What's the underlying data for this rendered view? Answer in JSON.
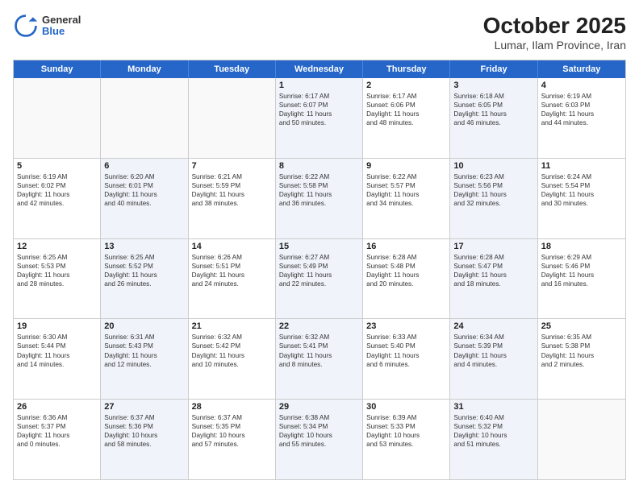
{
  "header": {
    "logo_general": "General",
    "logo_blue": "Blue",
    "title": "October 2025",
    "subtitle": "Lumar, Ilam Province, Iran"
  },
  "weekdays": [
    "Sunday",
    "Monday",
    "Tuesday",
    "Wednesday",
    "Thursday",
    "Friday",
    "Saturday"
  ],
  "rows": [
    [
      {
        "day": "",
        "lines": [],
        "empty": true
      },
      {
        "day": "",
        "lines": [],
        "empty": true
      },
      {
        "day": "",
        "lines": [],
        "empty": true
      },
      {
        "day": "1",
        "lines": [
          "Sunrise: 6:17 AM",
          "Sunset: 6:07 PM",
          "Daylight: 11 hours",
          "and 50 minutes."
        ],
        "shaded": true
      },
      {
        "day": "2",
        "lines": [
          "Sunrise: 6:17 AM",
          "Sunset: 6:06 PM",
          "Daylight: 11 hours",
          "and 48 minutes."
        ]
      },
      {
        "day": "3",
        "lines": [
          "Sunrise: 6:18 AM",
          "Sunset: 6:05 PM",
          "Daylight: 11 hours",
          "and 46 minutes."
        ],
        "shaded": true
      },
      {
        "day": "4",
        "lines": [
          "Sunrise: 6:19 AM",
          "Sunset: 6:03 PM",
          "Daylight: 11 hours",
          "and 44 minutes."
        ]
      }
    ],
    [
      {
        "day": "5",
        "lines": [
          "Sunrise: 6:19 AM",
          "Sunset: 6:02 PM",
          "Daylight: 11 hours",
          "and 42 minutes."
        ]
      },
      {
        "day": "6",
        "lines": [
          "Sunrise: 6:20 AM",
          "Sunset: 6:01 PM",
          "Daylight: 11 hours",
          "and 40 minutes."
        ],
        "shaded": true
      },
      {
        "day": "7",
        "lines": [
          "Sunrise: 6:21 AM",
          "Sunset: 5:59 PM",
          "Daylight: 11 hours",
          "and 38 minutes."
        ]
      },
      {
        "day": "8",
        "lines": [
          "Sunrise: 6:22 AM",
          "Sunset: 5:58 PM",
          "Daylight: 11 hours",
          "and 36 minutes."
        ],
        "shaded": true
      },
      {
        "day": "9",
        "lines": [
          "Sunrise: 6:22 AM",
          "Sunset: 5:57 PM",
          "Daylight: 11 hours",
          "and 34 minutes."
        ]
      },
      {
        "day": "10",
        "lines": [
          "Sunrise: 6:23 AM",
          "Sunset: 5:56 PM",
          "Daylight: 11 hours",
          "and 32 minutes."
        ],
        "shaded": true
      },
      {
        "day": "11",
        "lines": [
          "Sunrise: 6:24 AM",
          "Sunset: 5:54 PM",
          "Daylight: 11 hours",
          "and 30 minutes."
        ]
      }
    ],
    [
      {
        "day": "12",
        "lines": [
          "Sunrise: 6:25 AM",
          "Sunset: 5:53 PM",
          "Daylight: 11 hours",
          "and 28 minutes."
        ]
      },
      {
        "day": "13",
        "lines": [
          "Sunrise: 6:25 AM",
          "Sunset: 5:52 PM",
          "Daylight: 11 hours",
          "and 26 minutes."
        ],
        "shaded": true
      },
      {
        "day": "14",
        "lines": [
          "Sunrise: 6:26 AM",
          "Sunset: 5:51 PM",
          "Daylight: 11 hours",
          "and 24 minutes."
        ]
      },
      {
        "day": "15",
        "lines": [
          "Sunrise: 6:27 AM",
          "Sunset: 5:49 PM",
          "Daylight: 11 hours",
          "and 22 minutes."
        ],
        "shaded": true
      },
      {
        "day": "16",
        "lines": [
          "Sunrise: 6:28 AM",
          "Sunset: 5:48 PM",
          "Daylight: 11 hours",
          "and 20 minutes."
        ]
      },
      {
        "day": "17",
        "lines": [
          "Sunrise: 6:28 AM",
          "Sunset: 5:47 PM",
          "Daylight: 11 hours",
          "and 18 minutes."
        ],
        "shaded": true
      },
      {
        "day": "18",
        "lines": [
          "Sunrise: 6:29 AM",
          "Sunset: 5:46 PM",
          "Daylight: 11 hours",
          "and 16 minutes."
        ]
      }
    ],
    [
      {
        "day": "19",
        "lines": [
          "Sunrise: 6:30 AM",
          "Sunset: 5:44 PM",
          "Daylight: 11 hours",
          "and 14 minutes."
        ]
      },
      {
        "day": "20",
        "lines": [
          "Sunrise: 6:31 AM",
          "Sunset: 5:43 PM",
          "Daylight: 11 hours",
          "and 12 minutes."
        ],
        "shaded": true
      },
      {
        "day": "21",
        "lines": [
          "Sunrise: 6:32 AM",
          "Sunset: 5:42 PM",
          "Daylight: 11 hours",
          "and 10 minutes."
        ]
      },
      {
        "day": "22",
        "lines": [
          "Sunrise: 6:32 AM",
          "Sunset: 5:41 PM",
          "Daylight: 11 hours",
          "and 8 minutes."
        ],
        "shaded": true
      },
      {
        "day": "23",
        "lines": [
          "Sunrise: 6:33 AM",
          "Sunset: 5:40 PM",
          "Daylight: 11 hours",
          "and 6 minutes."
        ]
      },
      {
        "day": "24",
        "lines": [
          "Sunrise: 6:34 AM",
          "Sunset: 5:39 PM",
          "Daylight: 11 hours",
          "and 4 minutes."
        ],
        "shaded": true
      },
      {
        "day": "25",
        "lines": [
          "Sunrise: 6:35 AM",
          "Sunset: 5:38 PM",
          "Daylight: 11 hours",
          "and 2 minutes."
        ]
      }
    ],
    [
      {
        "day": "26",
        "lines": [
          "Sunrise: 6:36 AM",
          "Sunset: 5:37 PM",
          "Daylight: 11 hours",
          "and 0 minutes."
        ]
      },
      {
        "day": "27",
        "lines": [
          "Sunrise: 6:37 AM",
          "Sunset: 5:36 PM",
          "Daylight: 10 hours",
          "and 58 minutes."
        ],
        "shaded": true
      },
      {
        "day": "28",
        "lines": [
          "Sunrise: 6:37 AM",
          "Sunset: 5:35 PM",
          "Daylight: 10 hours",
          "and 57 minutes."
        ]
      },
      {
        "day": "29",
        "lines": [
          "Sunrise: 6:38 AM",
          "Sunset: 5:34 PM",
          "Daylight: 10 hours",
          "and 55 minutes."
        ],
        "shaded": true
      },
      {
        "day": "30",
        "lines": [
          "Sunrise: 6:39 AM",
          "Sunset: 5:33 PM",
          "Daylight: 10 hours",
          "and 53 minutes."
        ]
      },
      {
        "day": "31",
        "lines": [
          "Sunrise: 6:40 AM",
          "Sunset: 5:32 PM",
          "Daylight: 10 hours",
          "and 51 minutes."
        ],
        "shaded": true
      },
      {
        "day": "",
        "lines": [],
        "empty": true
      }
    ]
  ]
}
